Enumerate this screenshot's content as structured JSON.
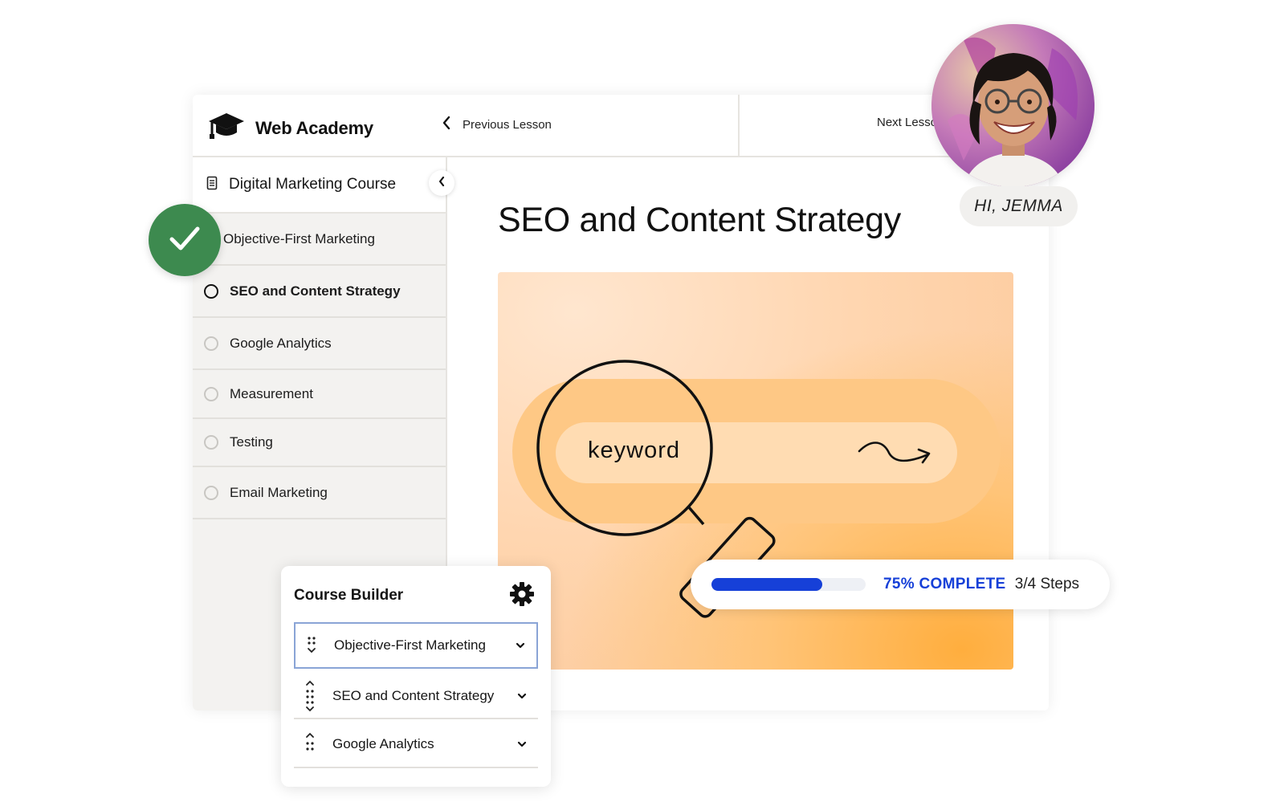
{
  "app": {
    "brand_name": "Web Academy",
    "previous_lesson_label": "Previous Lesson",
    "next_lesson_label": "Next Lesson"
  },
  "sidebar": {
    "course_title": "Digital Marketing Course",
    "lessons": [
      {
        "label": "Objective-First Marketing",
        "status": "complete"
      },
      {
        "label": "SEO and Content Strategy",
        "status": "current"
      },
      {
        "label": "Google Analytics",
        "status": "incomplete"
      },
      {
        "label": "Measurement",
        "status": "incomplete"
      },
      {
        "label": "Testing",
        "status": "incomplete"
      },
      {
        "label": "Email Marketing",
        "status": "incomplete"
      }
    ]
  },
  "content": {
    "lesson_title": "SEO and Content Strategy",
    "hero_keyword": "keyword"
  },
  "progress": {
    "percent_label": "75% COMPLETE",
    "steps_label": "3/4 Steps",
    "fraction": 0.72
  },
  "course_builder": {
    "title": "Course Builder",
    "rows": [
      {
        "label": "Objective-First Marketing",
        "selected": true
      },
      {
        "label": "SEO and Content Strategy",
        "selected": false
      },
      {
        "label": "Google Analytics",
        "selected": false
      }
    ]
  },
  "user": {
    "greeting": "HI, JEMMA"
  },
  "colors": {
    "accent_blue": "#1640d8",
    "success_green": "#3d8a4f",
    "hero_orange": "#fec885"
  },
  "icons": [
    "graduation-cap-icon",
    "chevron-left-icon",
    "document-icon",
    "check-icon",
    "gear-icon",
    "drag-handle-icon",
    "chevron-down-icon",
    "magnifier-illustration",
    "squiggle-arrow-icon"
  ]
}
